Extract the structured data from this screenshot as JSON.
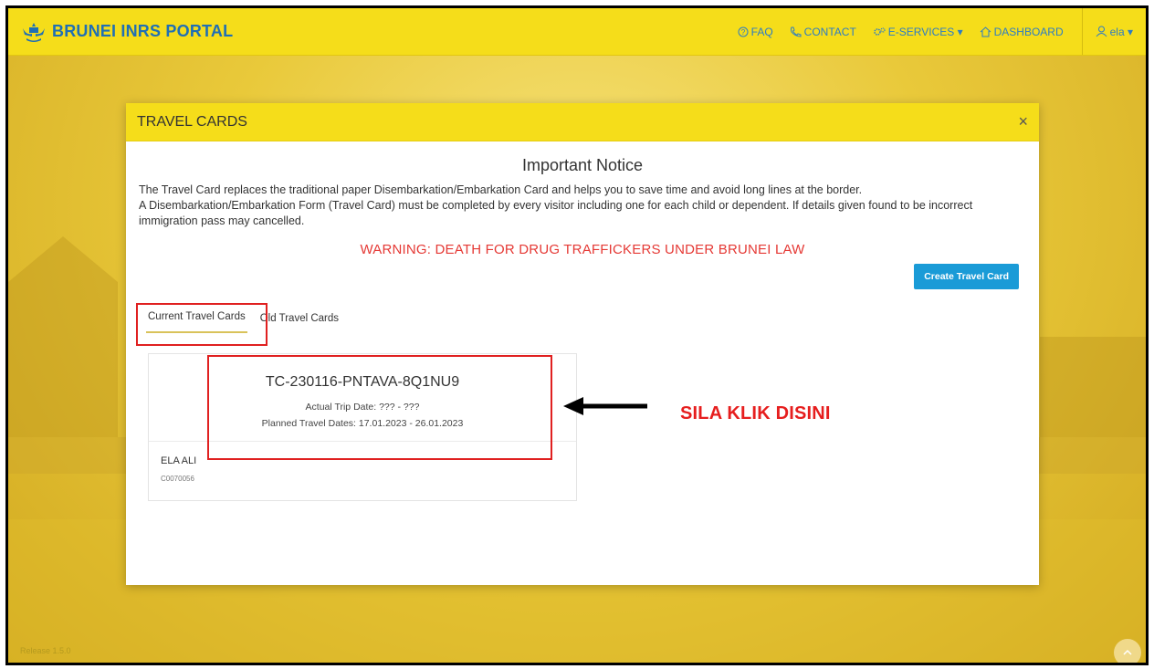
{
  "brand": {
    "title": "BRUNEI INRS PORTAL"
  },
  "nav": {
    "faq": "FAQ",
    "contact": "CONTACT",
    "eservices": "E-SERVICES ▾",
    "dashboard": "DASHBOARD",
    "user": "ela ▾"
  },
  "modal": {
    "title": "TRAVEL CARDS",
    "close": "×",
    "notice_title": "Important Notice",
    "notice_line1": "The Travel Card replaces the traditional paper Disembarkation/Embarkation Card and helps you to save time and avoid long lines at the border.",
    "notice_line2": "A Disembarkation/Embarkation Form (Travel Card) must be completed by every visitor including one for each child or dependent. If details given found to be incorrect immigration pass may cancelled.",
    "warning": "WARNING: DEATH FOR DRUG TRAFFICKERS UNDER BRUNEI LAW",
    "create_button": "Create Travel Card",
    "tabs": [
      "Current Travel Cards",
      "Old Travel Cards"
    ]
  },
  "card": {
    "id": "TC-230116-PNTAVA-8Q1NU9",
    "actual_trip": "Actual Trip Date: ??? - ???",
    "planned": "Planned Travel Dates: 17.01.2023 - 26.01.2023",
    "name": "ELA ALI",
    "code": "C0070056"
  },
  "annotation": {
    "text": "SILA KLIK DISINI"
  },
  "footer": {
    "release": "Release 1.5.0"
  },
  "colors": {
    "topbar": "#f5dd1a",
    "link": "#2c7cc5",
    "warning": "#e53935",
    "button": "#1a9bd7",
    "annotation": "#e61e1e"
  }
}
